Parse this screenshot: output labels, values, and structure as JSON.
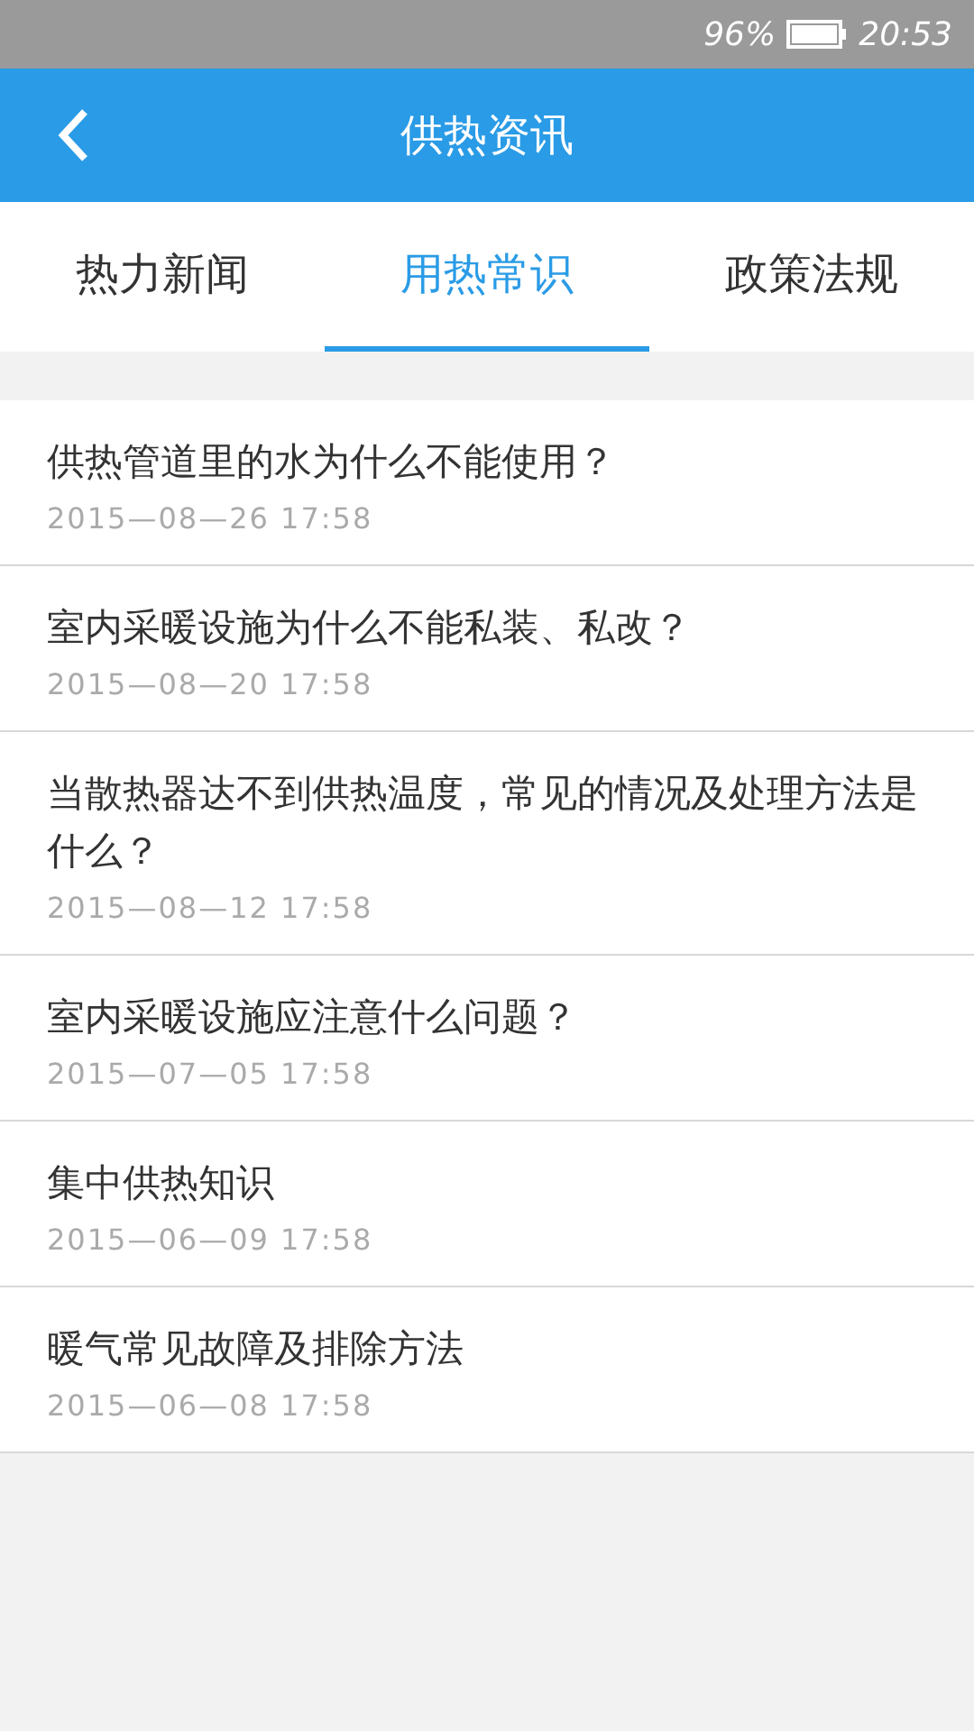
{
  "status_bar": {
    "battery_text": "96%",
    "time": "20:53"
  },
  "header": {
    "title": "供热资讯"
  },
  "tabs": [
    {
      "label": "热力新闻",
      "selected": false
    },
    {
      "label": "用热常识",
      "selected": true
    },
    {
      "label": "政策法规",
      "selected": false
    }
  ],
  "articles": [
    {
      "title": "供热管道里的水为什么不能使用？",
      "date": "2015—08—26  17:58"
    },
    {
      "title": "室内采暖设施为什么不能私装、私改？",
      "date": "2015—08—20  17:58"
    },
    {
      "title": "当散热器达不到供热温度，常见的情况及处理方法是什么？",
      "date": "2015—08—12  17:58"
    },
    {
      "title": "室内采暖设施应注意什么问题？",
      "date": "2015—07—05  17:58"
    },
    {
      "title": "集中供热知识",
      "date": "2015—06—09  17:58"
    },
    {
      "title": "暖气常见故障及排除方法",
      "date": "2015—06—08  17:58"
    }
  ]
}
